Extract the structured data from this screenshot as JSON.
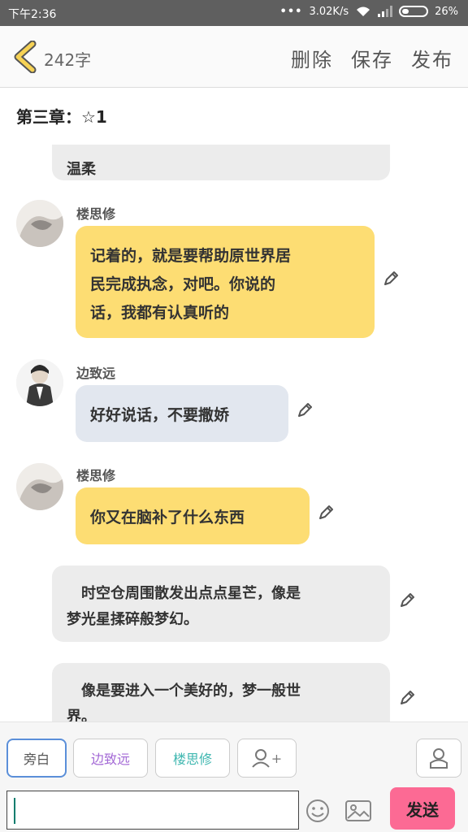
{
  "status_bar": {
    "time": "下午2:36",
    "signal_dots": "•••",
    "network_speed": "3.02K/s",
    "battery": "26%"
  },
  "nav": {
    "word_count": "242字",
    "delete_label": "删除",
    "save_label": "保存",
    "publish_label": "发布"
  },
  "chapter_title": "第三章：☆1",
  "messages": [
    {
      "type": "narration",
      "text": "温柔"
    },
    {
      "type": "dialogue",
      "speaker": "楼思修",
      "lines": [
        "记着的，就是要帮助原世界居",
        "民完成执念，对吧。你说的",
        "话，我都有认真听的"
      ]
    },
    {
      "type": "dialogue",
      "speaker": "边致远",
      "lines": [
        "好好说话，不要撒娇"
      ]
    },
    {
      "type": "dialogue",
      "speaker": "楼思修",
      "lines": [
        "你又在脑补了什么东西"
      ]
    },
    {
      "type": "narration",
      "lines": [
        "　时空仓周围散发出点点星芒，像是",
        "梦光星揉碎般梦幻。"
      ]
    },
    {
      "type": "narration",
      "lines": [
        "　像是要进入一个美好的，梦一般世",
        "界。"
      ]
    }
  ],
  "roles": [
    {
      "label": "旁白",
      "color": "#555555",
      "active": true
    },
    {
      "label": "边致远",
      "color": "#a46ad6",
      "active": false
    },
    {
      "label": "楼思修",
      "color": "#3fb7b0",
      "active": false
    }
  ],
  "add_role_label": "+",
  "input": {
    "value": ""
  },
  "send_label": "发送",
  "colors": {
    "statusbar": "#5f5f5f",
    "yellow_bubble": "#fddd73",
    "blue_bubble": "#e2e7ef",
    "narration_bubble": "#ececec",
    "send_button": "#fc6a94",
    "back_chevron": "#f6d255"
  }
}
